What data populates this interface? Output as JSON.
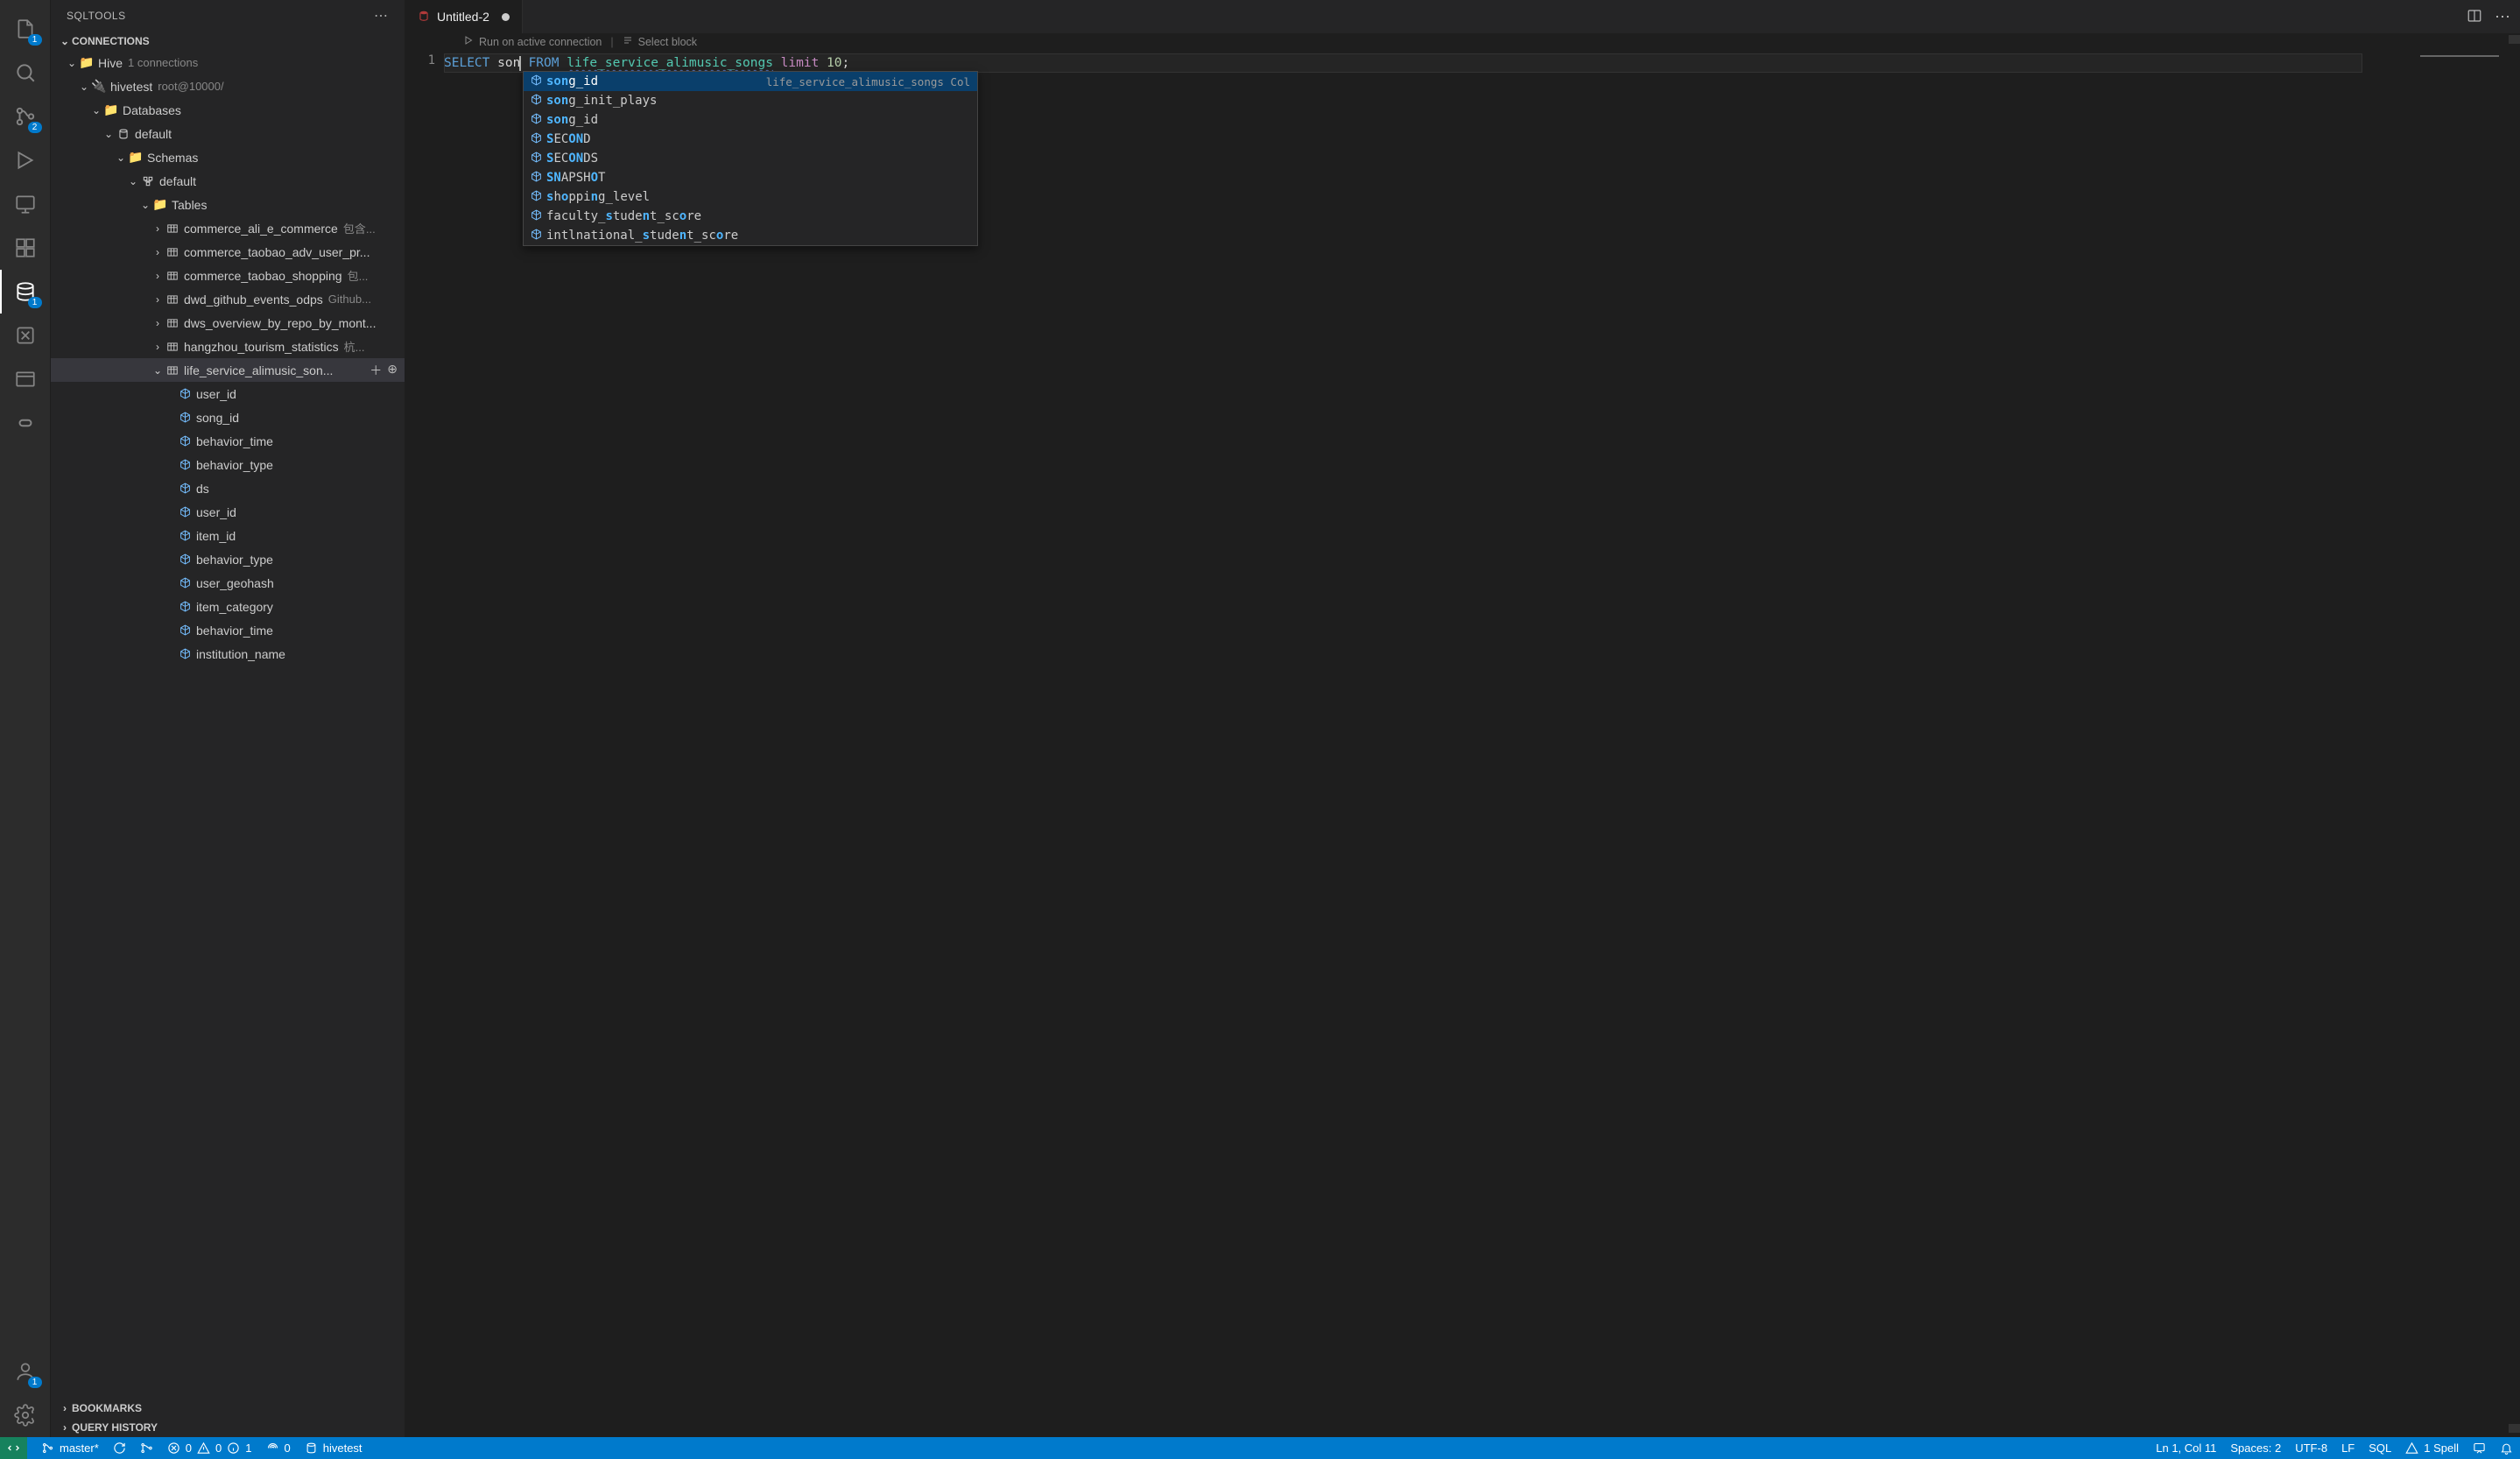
{
  "sidebar": {
    "panel_title": "SQLTOOLS",
    "connections_header": "CONNECTIONS",
    "bookmarks_header": "BOOKMARKS",
    "history_header": "QUERY HISTORY",
    "hive_label": "Hive",
    "hive_meta": "1 connections",
    "hivetest_label": "hivetest",
    "hivetest_meta": "root@10000/",
    "databases_label": "Databases",
    "db_default_label": "default",
    "schemas_label": "Schemas",
    "schema_default_label": "default",
    "tables_label": "Tables",
    "tables": [
      {
        "name": "commerce_ali_e_commerce",
        "meta": "包含..."
      },
      {
        "name": "commerce_taobao_adv_user_pr...",
        "meta": ""
      },
      {
        "name": "commerce_taobao_shopping",
        "meta": "包..."
      },
      {
        "name": "dwd_github_events_odps",
        "meta": "Github..."
      },
      {
        "name": "dws_overview_by_repo_by_mont...",
        "meta": ""
      },
      {
        "name": "hangzhou_tourism_statistics",
        "meta": "杭..."
      },
      {
        "name": "life_service_alimusic_son...",
        "meta": ""
      }
    ],
    "columns": [
      "user_id",
      "song_id",
      "behavior_time",
      "behavior_type",
      "ds",
      "user_id",
      "item_id",
      "behavior_type",
      "user_geohash",
      "item_category",
      "behavior_time",
      "institution_name"
    ]
  },
  "activity": {
    "explorer_badge": "1",
    "scm_badge": "2",
    "db_badge": "1",
    "account_badge": "1"
  },
  "tab": {
    "title": "Untitled-2"
  },
  "codelens": {
    "run": "Run on active connection",
    "select": "Select block"
  },
  "code": {
    "select": "SELECT",
    "typed": "son",
    "from": "FROM",
    "table": "life_service_alimusic_songs",
    "limit_kw": "limit",
    "limit_val": "10",
    "semi": ";"
  },
  "completion": {
    "detail": "life_service_alimusic_songs Col",
    "items": [
      {
        "pre": "son",
        "rest": "g_id"
      },
      {
        "pre": "son",
        "rest": "g_init_plays"
      },
      {
        "pre": "son",
        "rest": "g_id"
      },
      {
        "raw_html": "<span class='hl'>S</span>EC<span class='hl'>ON</span>D"
      },
      {
        "raw_html": "<span class='hl'>S</span>EC<span class='hl'>ON</span>DS"
      },
      {
        "raw_html": "<span class='hl'>SN</span>APSH<span class='hl'>O</span>T"
      },
      {
        "raw_html": "<span class='hl'>s</span>h<span class='hl'>o</span>ppi<span class='hl'>n</span>g_level"
      },
      {
        "raw_html": "faculty_<span class='hl'>s</span>tude<span class='hl'>n</span>t_sc<span class='hl'>o</span>re"
      },
      {
        "raw_html": "intlnational_<span class='hl'>s</span>tude<span class='hl'>n</span>t_sc<span class='hl'>o</span>re"
      }
    ]
  },
  "status": {
    "branch": "master*",
    "errors": "0",
    "warnings": "0",
    "info": "1",
    "radio": "0",
    "connection": "hivetest",
    "position": "Ln 1, Col 11",
    "spaces": "Spaces: 2",
    "encoding": "UTF-8",
    "eol": "LF",
    "lang": "SQL",
    "spell": "1 Spell"
  },
  "gutter": {
    "line1": "1"
  }
}
